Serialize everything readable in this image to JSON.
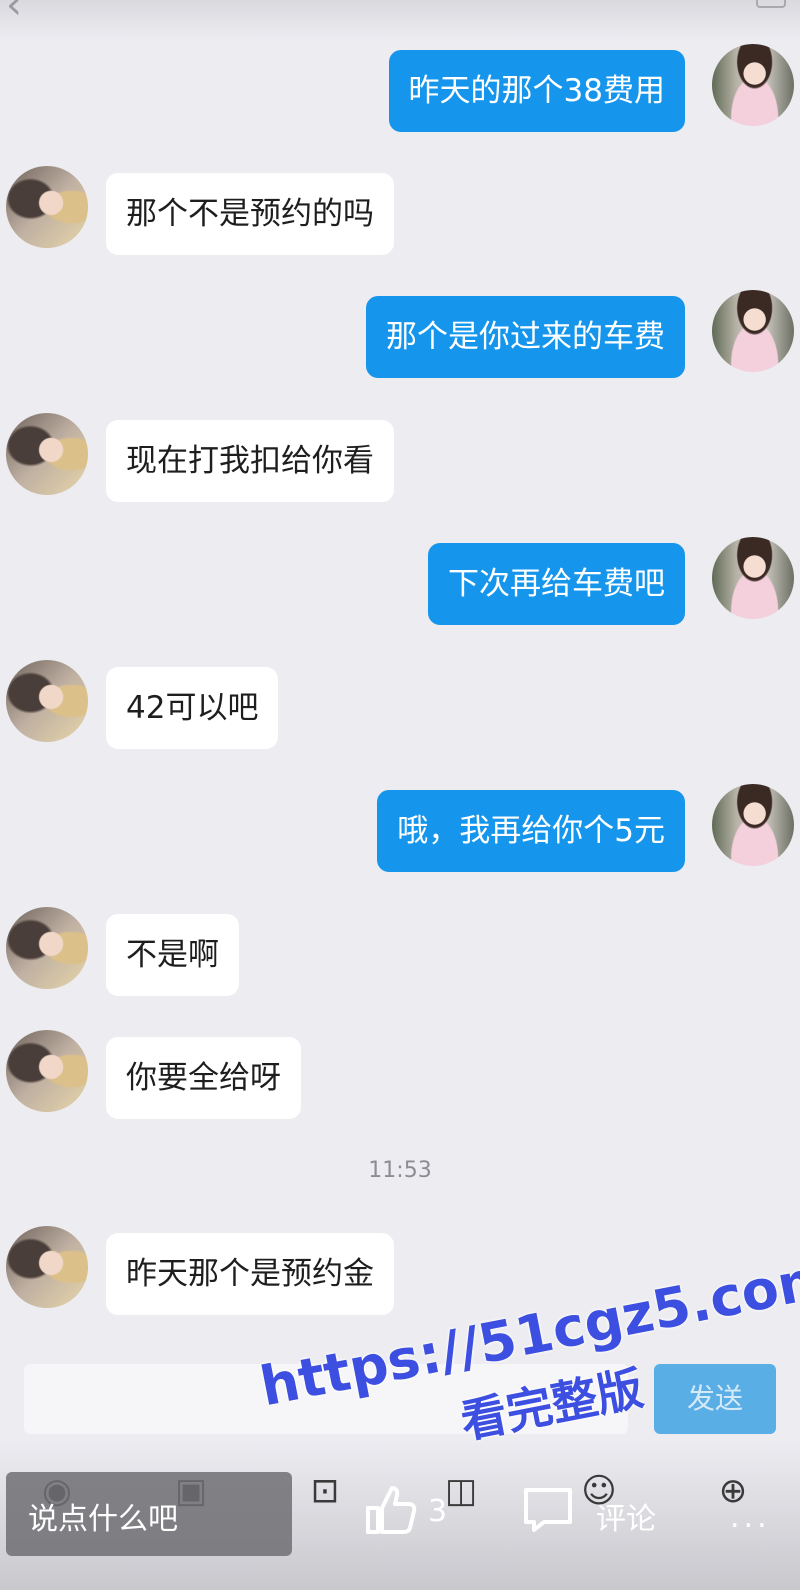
{
  "messages": [
    {
      "side": "me",
      "text": "昨天的那个38费用"
    },
    {
      "side": "them",
      "text": "那个不是预约的吗"
    },
    {
      "side": "me",
      "text": "那个是你过来的车费"
    },
    {
      "side": "them",
      "text": "现在打我扣给你看"
    },
    {
      "side": "me",
      "text": "下次再给车费吧"
    },
    {
      "side": "them",
      "text": "42可以吧"
    },
    {
      "side": "me",
      "text": "哦，我再给你个5元"
    },
    {
      "side": "them",
      "text": "不是啊"
    },
    {
      "side": "them",
      "text": "你要全给呀"
    },
    {
      "side": "them",
      "text": "昨天那个是预约金"
    }
  ],
  "timestamp": "11:53",
  "composer": {
    "send_label": "发送"
  },
  "bottom_bar": {
    "comment_placeholder": "说点什么吧",
    "like_count": "3",
    "comment_label": "评论",
    "more_label": "..."
  },
  "watermark": {
    "url": "https://51cgz5.com",
    "subtitle": "看完整版"
  }
}
